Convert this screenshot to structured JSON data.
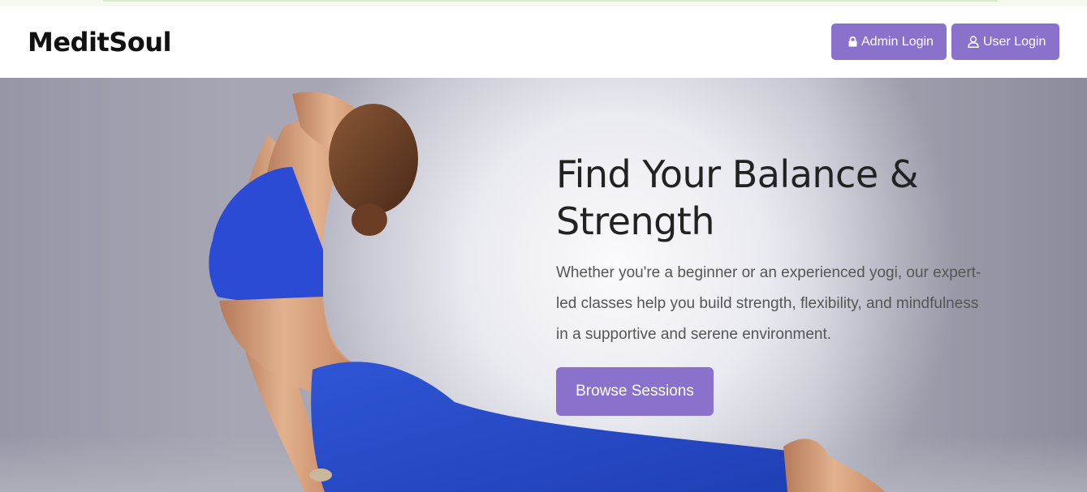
{
  "header": {
    "brand": "MeditSoul",
    "admin_login_label": "Admin Login",
    "user_login_label": "User Login",
    "admin_icon": "lock-icon",
    "user_icon": "user-icon"
  },
  "hero": {
    "title": "Find Your Balance & Strength",
    "description": "Whether you're a beginner or an experienced yogi, our expert-led classes help you build strength, flexibility, and mindfulness in a supportive and serene environment.",
    "cta_label": "Browse Sessions",
    "image": "yoga-pose-image"
  },
  "colors": {
    "accent": "#8a72cc",
    "heading": "#222222",
    "body_text": "#555555",
    "top_strip": "#f3faee"
  }
}
